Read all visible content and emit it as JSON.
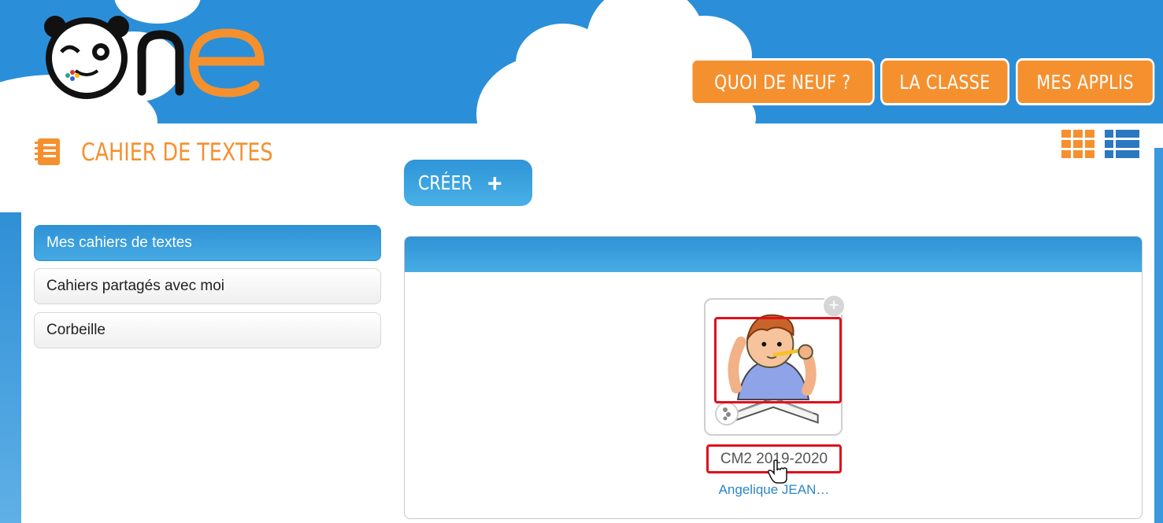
{
  "brand": {
    "logo_text": "one"
  },
  "nav": [
    {
      "label": "QUOI DE NEUF ?"
    },
    {
      "label": "LA CLASSE"
    },
    {
      "label": "MES APPLIS"
    }
  ],
  "page": {
    "title": "CAHIER DE TEXTES"
  },
  "toolbar": {
    "create_label": "CRÉER",
    "create_icon": "+"
  },
  "sidebar": {
    "items": [
      {
        "label": "Mes cahiers de textes",
        "active": true
      },
      {
        "label": "Cahiers partagés avec moi",
        "active": false
      },
      {
        "label": "Corbeille",
        "active": false
      }
    ]
  },
  "notebook": {
    "title": "CM2 2019-2020",
    "owner": "Angelique JEAN…"
  },
  "colors": {
    "accent_orange": "#f5902f",
    "accent_blue": "#2f92d6",
    "highlight_red": "#e0101a"
  }
}
